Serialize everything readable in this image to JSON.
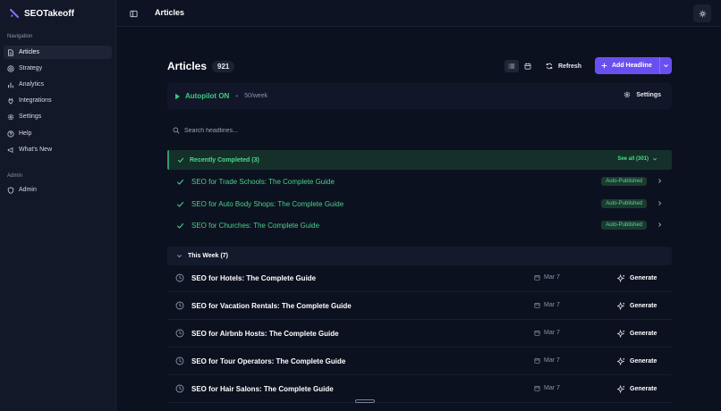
{
  "app": {
    "name": "SEOTakeoff"
  },
  "sidebar": {
    "nav_heading": "Navigation",
    "items": [
      {
        "label": "Articles",
        "icon": "file-text-icon",
        "active": true
      },
      {
        "label": "Strategy",
        "icon": "target-icon"
      },
      {
        "label": "Analytics",
        "icon": "bar-chart-icon"
      },
      {
        "label": "Integrations",
        "icon": "plug-icon"
      },
      {
        "label": "Settings",
        "icon": "gear-icon"
      },
      {
        "label": "Help",
        "icon": "help-circle-icon"
      },
      {
        "label": "What's New",
        "icon": "megaphone-icon"
      }
    ],
    "admin_heading": "Admin",
    "admin_items": [
      {
        "label": "Admin",
        "icon": "shield-icon"
      }
    ]
  },
  "topbar": {
    "title": "Articles"
  },
  "page": {
    "title": "Articles",
    "count": "921",
    "refresh_label": "Refresh",
    "add_label": "Add Headline"
  },
  "autopilot": {
    "status": "Autopilot ON",
    "rate": "50/week",
    "settings_label": "Settings"
  },
  "search": {
    "placeholder": "Search headlines..."
  },
  "completed": {
    "header": "Recently Completed (3)",
    "see_all": "See all (301)",
    "items": [
      {
        "title": "SEO for Trade Schools: The Complete Guide",
        "badge": "Auto-Published"
      },
      {
        "title": "SEO for Auto Body Shops: The Complete Guide",
        "badge": "Auto-Published"
      },
      {
        "title": "SEO for Churches: The Complete Guide",
        "badge": "Auto-Published"
      }
    ]
  },
  "this_week": {
    "header": "This Week (7)",
    "items": [
      {
        "title": "SEO for Hotels: The Complete Guide",
        "date": "Mar 7",
        "action": "Generate"
      },
      {
        "title": "SEO for Vacation Rentals: The Complete Guide",
        "date": "Mar 7",
        "action": "Generate"
      },
      {
        "title": "SEO for Airbnb Hosts: The Complete Guide",
        "date": "Mar 7",
        "action": "Generate"
      },
      {
        "title": "SEO for Tour Operators: The Complete Guide",
        "date": "Mar 7",
        "action": "Generate"
      },
      {
        "title": "SEO for Hair Salons: The Complete Guide",
        "date": "Mar 7",
        "action": "Generate"
      }
    ]
  },
  "colors": {
    "accent": "#6a4ff0",
    "success": "#49d186",
    "background": "#0c1120",
    "sidebar": "#121827"
  }
}
